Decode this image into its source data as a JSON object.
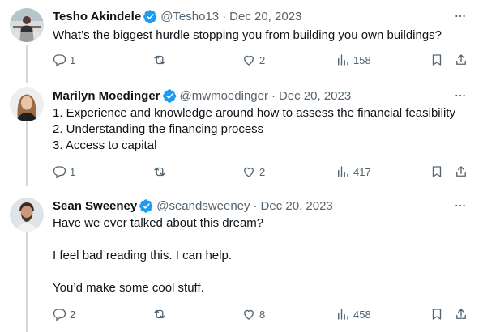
{
  "tweets": [
    {
      "name": "Tesho Akindele",
      "handle": "@Tesho13",
      "separator": "·",
      "date": "Dec 20, 2023",
      "lines": [
        "What’s the biggest hurdle stopping you from building you own buildings?"
      ],
      "replies": "1",
      "retweets": "",
      "likes": "2",
      "views": "158"
    },
    {
      "name": "Marilyn Moedinger",
      "handle": "@mwmoedinger",
      "separator": "·",
      "date": "Dec 20, 2023",
      "lines": [
        "1. Experience and knowledge around how to assess the financial feasibility",
        "2. Understanding the financing process",
        "3. Access to capital"
      ],
      "replies": "1",
      "retweets": "",
      "likes": "2",
      "views": "417"
    },
    {
      "name": "Sean Sweeney",
      "handle": "@seandsweeney",
      "separator": "·",
      "date": "Dec 20, 2023",
      "lines": [
        "Have we ever talked about this dream?",
        "",
        "I feel bad reading this. I can help.",
        "",
        "You’d make some cool stuff."
      ],
      "replies": "2",
      "retweets": "",
      "likes": "8",
      "views": "458"
    }
  ],
  "colors": {
    "verified": "#1d9bf0",
    "muted": "#536471",
    "text": "#0f1419",
    "thread_line": "#cfd9de"
  },
  "icons": [
    "verified-badge-icon",
    "more-icon",
    "reply-icon",
    "retweet-icon",
    "like-icon",
    "views-icon",
    "bookmark-icon",
    "share-icon"
  ]
}
